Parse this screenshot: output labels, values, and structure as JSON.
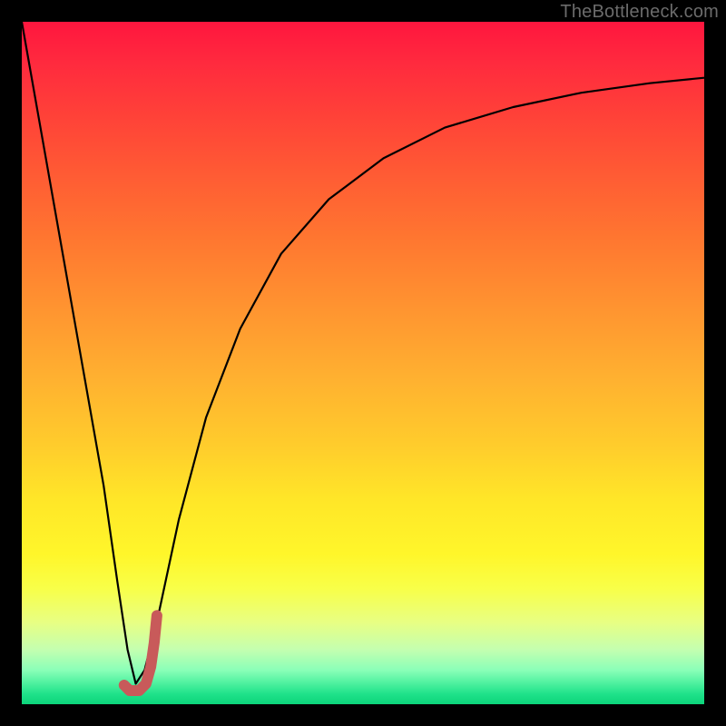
{
  "watermark": {
    "text": "TheBottleneck.com"
  },
  "chart_data": {
    "type": "line",
    "title": "",
    "xlabel": "",
    "ylabel": "",
    "xlim": [
      0,
      100
    ],
    "ylim": [
      0,
      100
    ],
    "grid": false,
    "legend": false,
    "gradient_stops": [
      {
        "pos": 0,
        "color": "#ff163e"
      },
      {
        "pos": 50,
        "color": "#ffb030"
      },
      {
        "pos": 80,
        "color": "#fff62a"
      },
      {
        "pos": 100,
        "color": "#0cd47a"
      }
    ],
    "series": [
      {
        "name": "bottleneck-curve",
        "stroke": "#000000",
        "stroke_width": 2.2,
        "x": [
          0,
          3,
          6,
          9,
          12,
          14,
          15.5,
          16.7,
          18,
          20,
          23,
          27,
          32,
          38,
          45,
          53,
          62,
          72,
          82,
          92,
          100
        ],
        "values": [
          100,
          83,
          66,
          49,
          32,
          18,
          8,
          3,
          5,
          13,
          27,
          42,
          55,
          66,
          74,
          80,
          84.5,
          87.5,
          89.6,
          91.0,
          91.8
        ]
      },
      {
        "name": "marker-j",
        "stroke": "#c85a5a",
        "stroke_width": 12,
        "linecap": "round",
        "x": [
          15.0,
          15.8,
          17.2,
          18.2,
          18.9,
          19.4,
          19.8
        ],
        "values": [
          2.8,
          2.0,
          2.0,
          3.0,
          5.5,
          9.0,
          13.0
        ]
      }
    ]
  }
}
